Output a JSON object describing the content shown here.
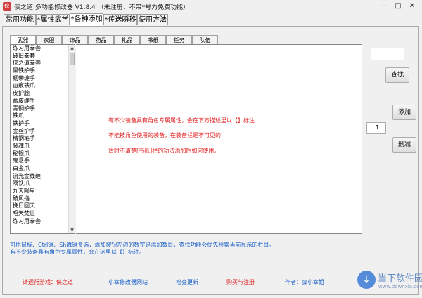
{
  "window": {
    "title": "侠之道 多功能修改器 V1.8.4 （未注册，不带*号为免费功能）",
    "min_symbol": "—",
    "max_symbol": "□",
    "close_symbol": "✕"
  },
  "main_tabs": [
    {
      "label": "常用功能"
    },
    {
      "label": "*属性武学"
    },
    {
      "label": "*各种添加",
      "active": true
    },
    {
      "label": "*传送瞬移"
    },
    {
      "label": "使用方法"
    }
  ],
  "sub_tabs": [
    "武器",
    "衣服",
    "饰品",
    "药品",
    "礼品",
    "书纸",
    "任务",
    "队伍"
  ],
  "item_list": [
    "练习用拳套",
    "破旧拳套",
    "侠之道拳套",
    "黑铁护手",
    "韧带缠手",
    "血痕铁爪",
    "皮护腕",
    "蓄皮缠手",
    "青铜护手",
    "铁爪",
    "铁护手",
    "金丝护手",
    "精钢笔手",
    "裂魂爪",
    "秘银爪",
    "鬼悬手",
    "白金爪",
    "流光金线缠",
    "陨铁爪",
    "九天陨星",
    "破风指",
    "挽日回天",
    "昭天焚世",
    "练习用拳套"
  ],
  "description": [
    "有不少装备具有角色专属属性，会在下方描述里以【】标注",
    "不能被角色使用的装备，在装备栏是不可见的",
    "暂时不清楚[书纸]栏的功法添加后如何使用。"
  ],
  "search": {
    "value": "",
    "button": "查找"
  },
  "add": {
    "button": "添加",
    "quantity": "1"
  },
  "delete_button": "删减",
  "hints": [
    "可用鼠标、Ctrl键、Shift键多选，添加按钮左边的数字是添加数目，查找功能会优先检索当前显示的栏目。",
    "有不少装备具有角色专属属性，会在这里以【】标注。"
  ],
  "footer": {
    "game_notice": "请运行游戏：侠之道",
    "site_link": "小幸修改器网站",
    "update_link": "检查更新",
    "register_link": "购买与注册",
    "author": "作者：@小幸姐"
  },
  "watermark": {
    "title": "当下软件园",
    "url": "www.downxia.com"
  },
  "colors": {
    "description_red": "#e02020",
    "hint_blue": "#1a5fc9"
  }
}
